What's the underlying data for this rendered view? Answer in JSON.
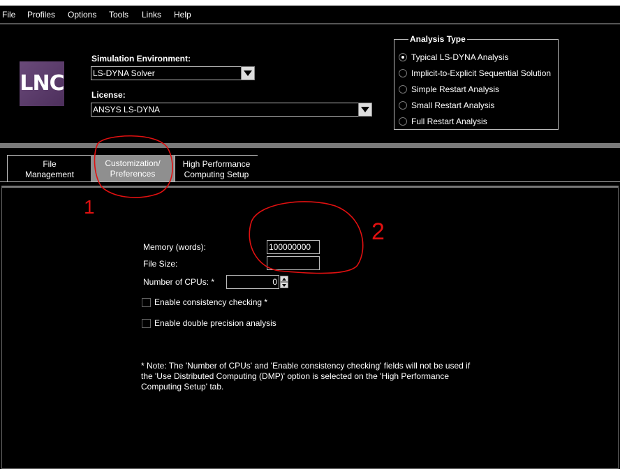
{
  "menu": {
    "items": [
      "File",
      "Profiles",
      "Options",
      "Tools",
      "Links",
      "Help"
    ]
  },
  "logo": {
    "text": "LNC"
  },
  "simulation_environment": {
    "label": "Simulation Environment:",
    "value": "LS-DYNA Solver"
  },
  "license": {
    "label": "License:",
    "value": "ANSYS LS-DYNA"
  },
  "analysis_type": {
    "title": "Analysis Type",
    "options": [
      {
        "label": "Typical LS-DYNA Analysis",
        "selected": true
      },
      {
        "label": "Implicit-to-Explicit Sequential Solution",
        "selected": false
      },
      {
        "label": "Simple Restart Analysis",
        "selected": false
      },
      {
        "label": "Small Restart Analysis",
        "selected": false
      },
      {
        "label": "Full Restart Analysis",
        "selected": false
      }
    ]
  },
  "tabs": [
    {
      "line1": "File",
      "line2": "Management",
      "active": false
    },
    {
      "line1": "Customization/",
      "line2": "Preferences",
      "active": true
    },
    {
      "line1": "High Performance",
      "line2": "Computing Setup",
      "active": false
    }
  ],
  "form": {
    "memory_label": "Memory (words):",
    "memory_value": "100000000",
    "file_size_label": "File Size:",
    "file_size_value": "",
    "cpus_label": "Number of CPUs: *",
    "cpus_value": "0",
    "consistency_label": "Enable consistency checking  *",
    "double_precision_label": "Enable double precision analysis"
  },
  "note": "*  Note: The 'Number of CPUs' and 'Enable consistency checking' fields will not be used if\nthe 'Use Distributed Computing (DMP)' option is selected on the 'High Performance\nComputing Setup' tab.",
  "annotations": {
    "mark_1": "1",
    "mark_2": "2",
    "color": "#e01010"
  },
  "colors": {
    "background": "#000000",
    "active_tab": "#8f8f8f",
    "separator_band": "#7a7a7a",
    "logo": "#5a3a6a"
  }
}
